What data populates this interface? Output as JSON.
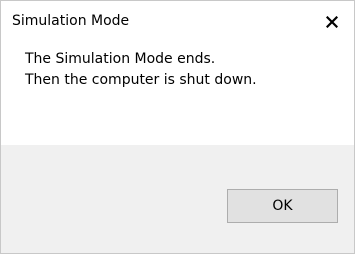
{
  "dialog": {
    "title": "Simulation Mode",
    "close_icon": "close-icon",
    "message_lines": [
      "The Simulation Mode ends.",
      "Then the computer is shut down."
    ],
    "ok_label": "OK"
  },
  "colors": {
    "background": "#ffffff",
    "footer_background": "#f0f0f0",
    "button_background": "#e1e1e1",
    "button_border": "#adadad",
    "text": "#000000"
  }
}
